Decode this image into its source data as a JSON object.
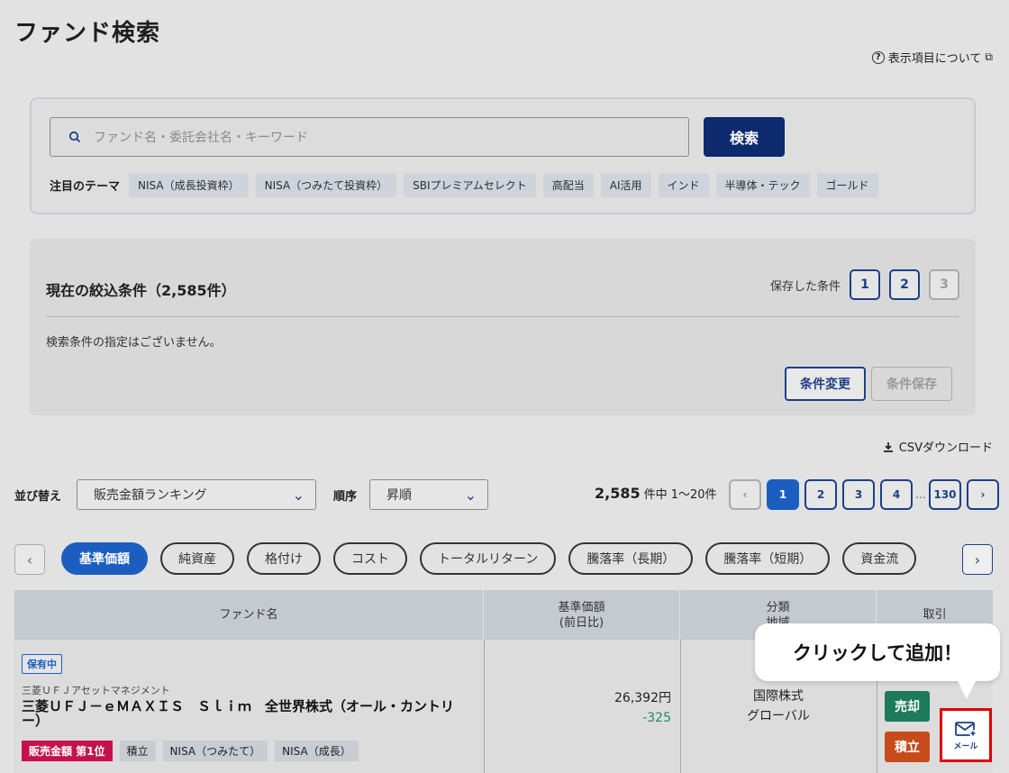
{
  "page": {
    "title": "ファンド検索",
    "about_link": "表示項目について"
  },
  "search": {
    "placeholder": "ファンド名・委託会社名・キーワード",
    "button_label": "検索",
    "themes_label": "注目のテーマ",
    "themes": [
      "NISA（成長投資枠）",
      "NISA（つみたて投資枠）",
      "SBIプレミアムセレクト",
      "高配当",
      "AI活用",
      "インド",
      "半導体・テック",
      "ゴールド"
    ]
  },
  "conditions": {
    "title": "現在の絞込条件（2,585件）",
    "saved_label": "保存した条件",
    "saved_slots": [
      "1",
      "2",
      "3"
    ],
    "empty_text": "検索条件の指定はございません。",
    "change_label": "条件変更",
    "save_label": "条件保存"
  },
  "csv_label": "CSVダウンロード",
  "sort": {
    "label": "並び替え",
    "value": "販売金額ランキング",
    "order_label": "順序",
    "order_value": "昇順"
  },
  "pagination": {
    "total": "2,585",
    "range_text": "件中 1〜20件",
    "pages": [
      "1",
      "2",
      "3",
      "4"
    ],
    "ellipsis": "…",
    "last_page": "130",
    "current": "1"
  },
  "tabs": [
    "基準価額",
    "純資産",
    "格付け",
    "コスト",
    "トータルリターン",
    "騰落率（長期）",
    "騰落率（短期）",
    "資金流"
  ],
  "table": {
    "headers": {
      "fund_name": "ファンド名",
      "price_line1": "基準価額",
      "price_line2": "(前日比)",
      "category_line1": "分類",
      "category_line2": "地域",
      "trade": "取引"
    },
    "rows": [
      {
        "holding_badge": "保有中",
        "company": "三菱ＵＦＪアセットマネジメント",
        "name": "三菱ＵＦＪ－ｅＭＡＸＩＳ　Ｓｌｉｍ　全世界株式（オール・カントリー）",
        "badges": [
          "販売金額 第1位",
          "積立",
          "NISA（つみたて）",
          "NISA（成長）"
        ],
        "price": "26,392円",
        "change": "-325",
        "category": "国際株式",
        "region": "グローバル",
        "sell_label": "売却",
        "tsumitate_label": "積立",
        "mail_label": "メール"
      }
    ]
  },
  "tooltip": {
    "text": "クリックして追加！"
  },
  "colors": {
    "navy": "#0d2a6e",
    "accent_blue": "#1c5ec0",
    "rank_red": "#c4124c",
    "sell_green": "#1d7a5a",
    "tsumitate_orange": "#c84b1c",
    "highlight_red": "#e00000"
  }
}
